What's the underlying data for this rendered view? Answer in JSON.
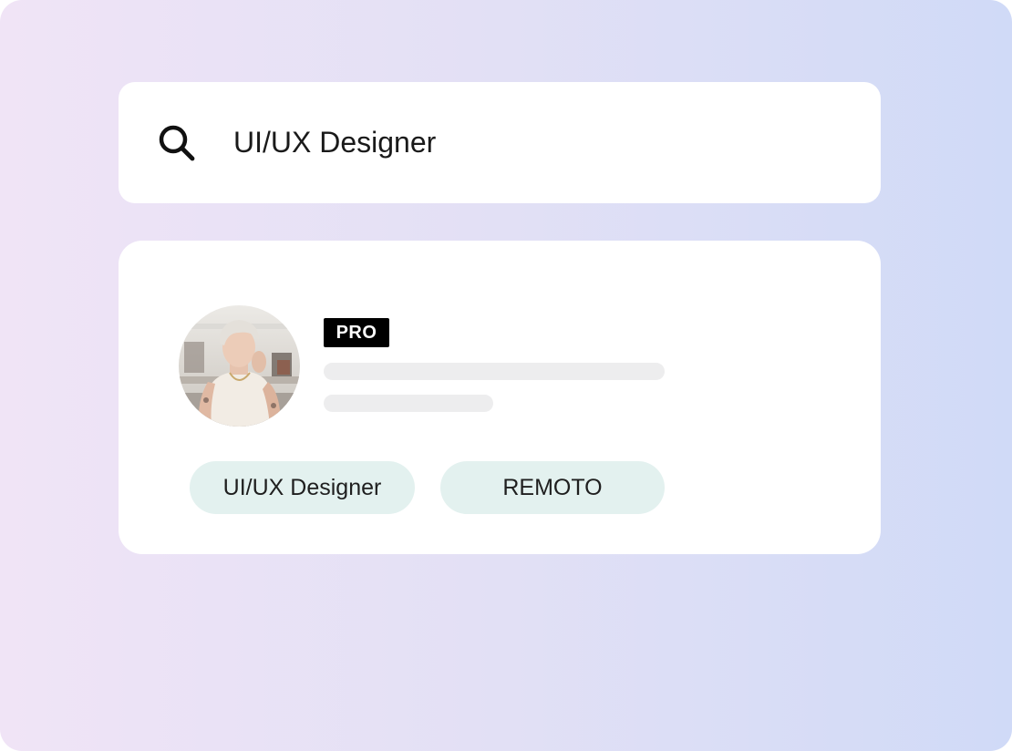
{
  "search": {
    "query": "UI/UX Designer",
    "icon": "search-icon"
  },
  "profile": {
    "badge": "PRO",
    "tags": [
      "UI/UX Designer",
      "REMOTO"
    ]
  },
  "colors": {
    "gradient_start": "#f0e4f6",
    "gradient_end": "#d0daf7",
    "badge_bg": "#000000",
    "tag_bg": "#e3f1ef",
    "skeleton": "#ededee"
  }
}
